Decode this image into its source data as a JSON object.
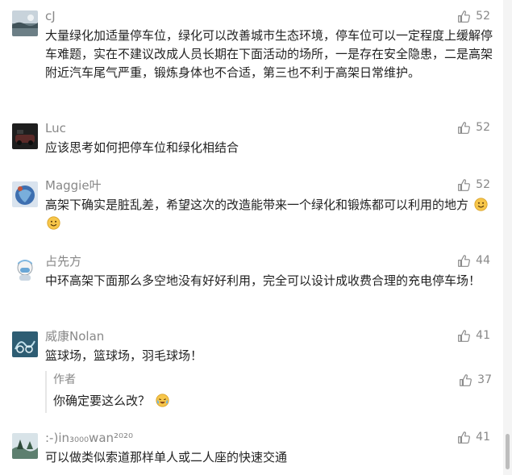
{
  "comments": [
    {
      "name": "cJ",
      "likes": "52",
      "text": "大量绿化加适量停车位，绿化可以改善城市生态环境，停车位可以一定程度上缓解停车难题，实在不建议改成人员长期在下面活动的场所，一是存在安全隐患，二是高架附近汽车尾气严重，锻炼身体也不合适，第三也不利于高架日常维护。"
    },
    {
      "name": "Luc",
      "likes": "52",
      "text": "应该思考如何把停车位和绿化相结合"
    },
    {
      "name": "Maggie叶",
      "likes": "52",
      "text": "高架下确实是脏乱差，希望这次的改造能带来一个绿化和锻炼都可以利用的地方"
    },
    {
      "name": "占先方",
      "likes": "44",
      "text": "中环高架下面那么多空地没有好好利用，完全可以设计成收费合理的充电停车场！"
    },
    {
      "name": "威康Nolan",
      "likes": "41",
      "text": "篮球场，篮球场，羽毛球场！",
      "reply": {
        "name": "作者",
        "likes": "37",
        "text": "你确定要这么改？"
      }
    },
    {
      "name": ":-)in₃₀₀₀wan²⁰²⁰",
      "likes": "41",
      "text": "可以做类似索道那样单人或二人座的快速交通"
    }
  ],
  "icons": {
    "like": "thumbs-up-icon",
    "smile_emoji": "smile-emoji-icon",
    "cry_emoji": "laugh-cry-emoji-icon"
  },
  "colors": {
    "name": "#888888",
    "text": "#222222",
    "like": "#888888"
  }
}
